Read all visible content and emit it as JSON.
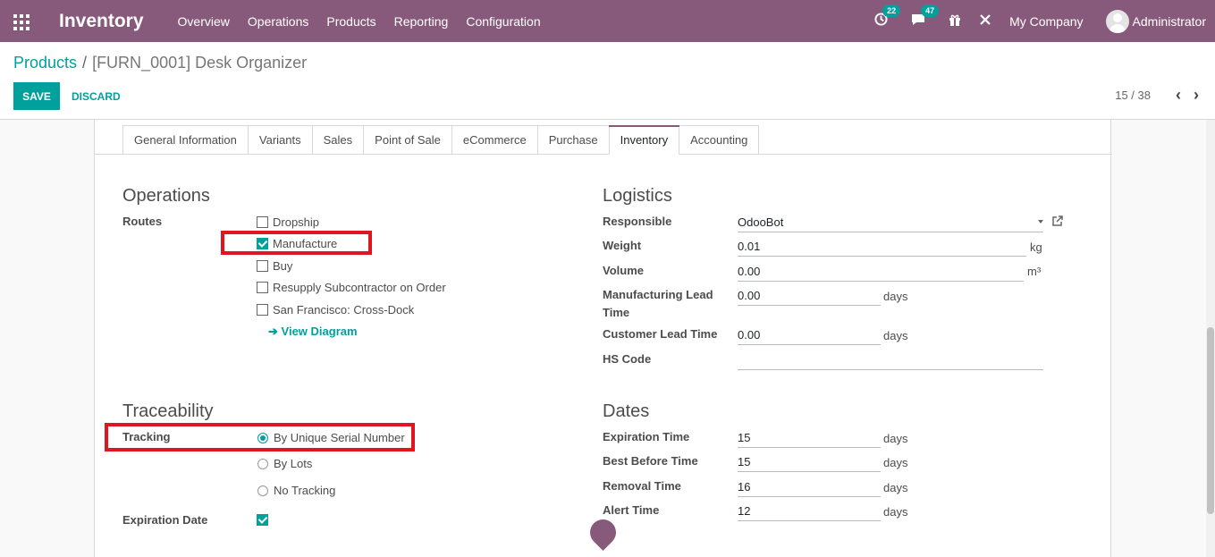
{
  "app": {
    "title": "Inventory",
    "menu": [
      "Overview",
      "Operations",
      "Products",
      "Reporting",
      "Configuration"
    ],
    "activity_count": "22",
    "message_count": "47",
    "company": "My Company",
    "user": "Administrator",
    "accent_color": "#875a7b",
    "primary_color": "#00a09d"
  },
  "breadcrumb": {
    "parent": "Products",
    "separator": "/",
    "current": "[FURN_0001] Desk Organizer"
  },
  "toolbar": {
    "save_label": "SAVE",
    "discard_label": "DISCARD",
    "pager": "15 / 38"
  },
  "tabs": [
    {
      "label": "General Information",
      "active": false
    },
    {
      "label": "Variants",
      "active": false
    },
    {
      "label": "Sales",
      "active": false
    },
    {
      "label": "Point of Sale",
      "active": false
    },
    {
      "label": "eCommerce",
      "active": false
    },
    {
      "label": "Purchase",
      "active": false
    },
    {
      "label": "Inventory",
      "active": true
    },
    {
      "label": "Accounting",
      "active": false
    }
  ],
  "operations": {
    "title": "Operations",
    "routes_label": "Routes",
    "routes": [
      {
        "label": "Dropship",
        "checked": false
      },
      {
        "label": "Manufacture",
        "checked": true
      },
      {
        "label": "Buy",
        "checked": false
      },
      {
        "label": "Resupply Subcontractor on Order",
        "checked": false
      },
      {
        "label": "San Francisco: Cross-Dock",
        "checked": false
      }
    ],
    "view_diagram": "View Diagram"
  },
  "logistics": {
    "title": "Logistics",
    "responsible_label": "Responsible",
    "responsible_value": "OdooBot",
    "weight_label": "Weight",
    "weight_value": "0.01",
    "weight_unit": "kg",
    "volume_label": "Volume",
    "volume_value": "0.00",
    "volume_unit": "m³",
    "mfg_lead_label_1": "Manufacturing Lead",
    "mfg_lead_label_2": "Time",
    "mfg_lead_value": "0.00",
    "mfg_lead_unit": "days",
    "customer_lead_label": "Customer Lead Time",
    "customer_lead_value": "0.00",
    "customer_lead_unit": "days",
    "hs_code_label": "HS Code",
    "hs_code_value": ""
  },
  "traceability": {
    "title": "Traceability",
    "tracking_label": "Tracking",
    "options": [
      {
        "label": "By Unique Serial Number",
        "checked": true
      },
      {
        "label": "By Lots",
        "checked": false
      },
      {
        "label": "No Tracking",
        "checked": false
      }
    ],
    "expiration_label": "Expiration Date",
    "expiration_checked": true
  },
  "dates": {
    "title": "Dates",
    "expiration_time_label": "Expiration Time",
    "expiration_time_value": "15",
    "best_before_label": "Best Before Time",
    "best_before_value": "15",
    "removal_label": "Removal Time",
    "removal_value": "16",
    "alert_label": "Alert Time",
    "alert_value": "12",
    "unit": "days"
  }
}
